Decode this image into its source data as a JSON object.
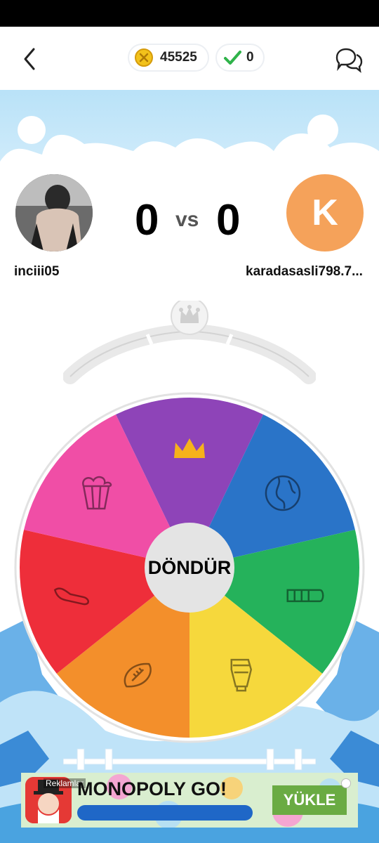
{
  "header": {
    "coins": "45525",
    "correct": "0"
  },
  "match": {
    "player1": {
      "name": "inciii05",
      "score": "0"
    },
    "player2": {
      "name": "karadasasli798.7...",
      "initial": "K",
      "score": "0"
    },
    "vs_label": "vs"
  },
  "wheel": {
    "spin_label": "DÖNDÜR",
    "segments": [
      {
        "category": "crown",
        "color": "#8e44b8"
      },
      {
        "category": "geography",
        "color": "#2a74c8"
      },
      {
        "category": "science",
        "color": "#25b25b"
      },
      {
        "category": "history",
        "color": "#f6d83c"
      },
      {
        "category": "sports",
        "color": "#f38f2b"
      },
      {
        "category": "art",
        "color": "#ee2e3a"
      },
      {
        "category": "entertainment",
        "color": "#f04ea6"
      }
    ]
  },
  "ad": {
    "label": "Reklamlar",
    "title": "MONOPOLY GO!",
    "cta": "YÜKLE"
  }
}
